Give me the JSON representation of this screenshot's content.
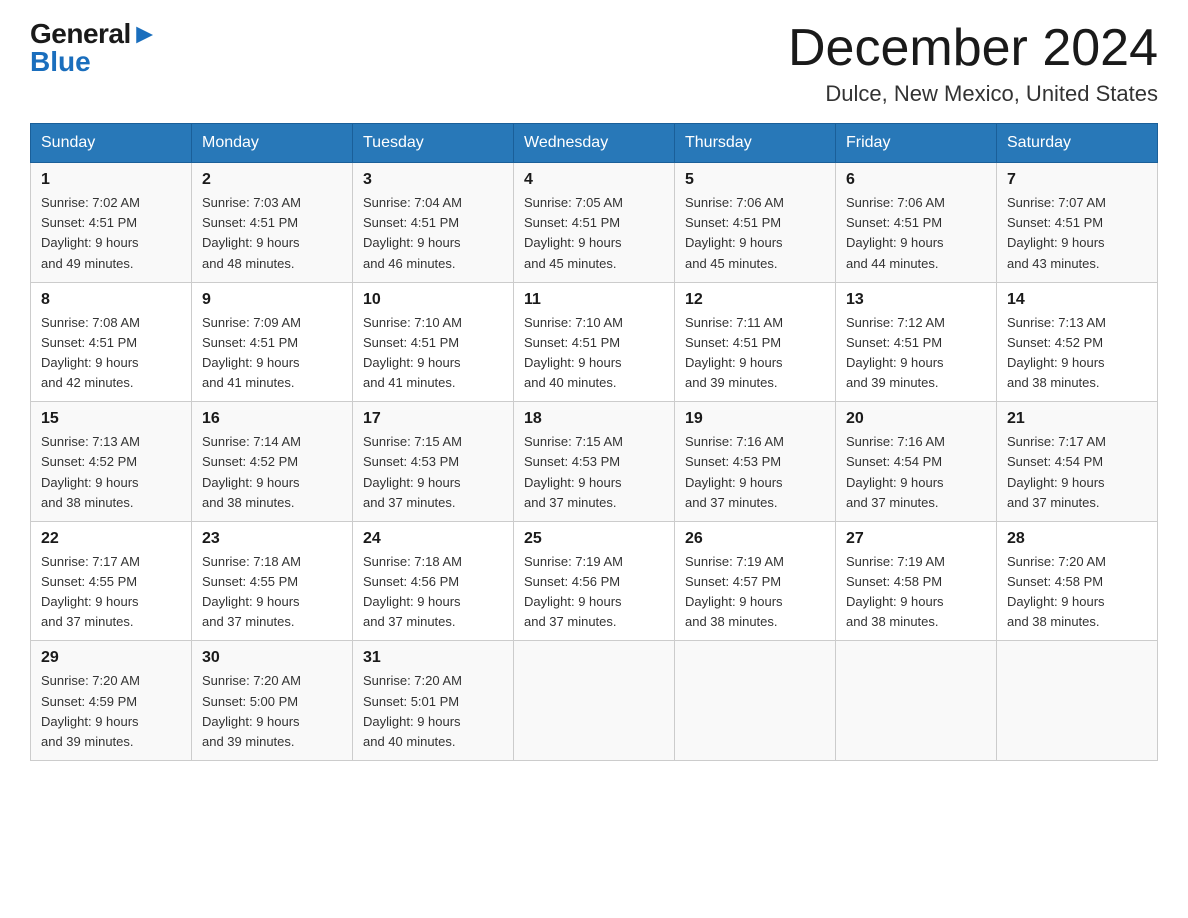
{
  "logo": {
    "general": "General",
    "blue": "Blue",
    "arrow": "▶"
  },
  "header": {
    "month_year": "December 2024",
    "location": "Dulce, New Mexico, United States"
  },
  "weekdays": [
    "Sunday",
    "Monday",
    "Tuesday",
    "Wednesday",
    "Thursday",
    "Friday",
    "Saturday"
  ],
  "weeks": [
    [
      {
        "day": "1",
        "sunrise": "7:02 AM",
        "sunset": "4:51 PM",
        "daylight": "9 hours and 49 minutes."
      },
      {
        "day": "2",
        "sunrise": "7:03 AM",
        "sunset": "4:51 PM",
        "daylight": "9 hours and 48 minutes."
      },
      {
        "day": "3",
        "sunrise": "7:04 AM",
        "sunset": "4:51 PM",
        "daylight": "9 hours and 46 minutes."
      },
      {
        "day": "4",
        "sunrise": "7:05 AM",
        "sunset": "4:51 PM",
        "daylight": "9 hours and 45 minutes."
      },
      {
        "day": "5",
        "sunrise": "7:06 AM",
        "sunset": "4:51 PM",
        "daylight": "9 hours and 45 minutes."
      },
      {
        "day": "6",
        "sunrise": "7:06 AM",
        "sunset": "4:51 PM",
        "daylight": "9 hours and 44 minutes."
      },
      {
        "day": "7",
        "sunrise": "7:07 AM",
        "sunset": "4:51 PM",
        "daylight": "9 hours and 43 minutes."
      }
    ],
    [
      {
        "day": "8",
        "sunrise": "7:08 AM",
        "sunset": "4:51 PM",
        "daylight": "9 hours and 42 minutes."
      },
      {
        "day": "9",
        "sunrise": "7:09 AM",
        "sunset": "4:51 PM",
        "daylight": "9 hours and 41 minutes."
      },
      {
        "day": "10",
        "sunrise": "7:10 AM",
        "sunset": "4:51 PM",
        "daylight": "9 hours and 41 minutes."
      },
      {
        "day": "11",
        "sunrise": "7:10 AM",
        "sunset": "4:51 PM",
        "daylight": "9 hours and 40 minutes."
      },
      {
        "day": "12",
        "sunrise": "7:11 AM",
        "sunset": "4:51 PM",
        "daylight": "9 hours and 39 minutes."
      },
      {
        "day": "13",
        "sunrise": "7:12 AM",
        "sunset": "4:51 PM",
        "daylight": "9 hours and 39 minutes."
      },
      {
        "day": "14",
        "sunrise": "7:13 AM",
        "sunset": "4:52 PM",
        "daylight": "9 hours and 38 minutes."
      }
    ],
    [
      {
        "day": "15",
        "sunrise": "7:13 AM",
        "sunset": "4:52 PM",
        "daylight": "9 hours and 38 minutes."
      },
      {
        "day": "16",
        "sunrise": "7:14 AM",
        "sunset": "4:52 PM",
        "daylight": "9 hours and 38 minutes."
      },
      {
        "day": "17",
        "sunrise": "7:15 AM",
        "sunset": "4:53 PM",
        "daylight": "9 hours and 37 minutes."
      },
      {
        "day": "18",
        "sunrise": "7:15 AM",
        "sunset": "4:53 PM",
        "daylight": "9 hours and 37 minutes."
      },
      {
        "day": "19",
        "sunrise": "7:16 AM",
        "sunset": "4:53 PM",
        "daylight": "9 hours and 37 minutes."
      },
      {
        "day": "20",
        "sunrise": "7:16 AM",
        "sunset": "4:54 PM",
        "daylight": "9 hours and 37 minutes."
      },
      {
        "day": "21",
        "sunrise": "7:17 AM",
        "sunset": "4:54 PM",
        "daylight": "9 hours and 37 minutes."
      }
    ],
    [
      {
        "day": "22",
        "sunrise": "7:17 AM",
        "sunset": "4:55 PM",
        "daylight": "9 hours and 37 minutes."
      },
      {
        "day": "23",
        "sunrise": "7:18 AM",
        "sunset": "4:55 PM",
        "daylight": "9 hours and 37 minutes."
      },
      {
        "day": "24",
        "sunrise": "7:18 AM",
        "sunset": "4:56 PM",
        "daylight": "9 hours and 37 minutes."
      },
      {
        "day": "25",
        "sunrise": "7:19 AM",
        "sunset": "4:56 PM",
        "daylight": "9 hours and 37 minutes."
      },
      {
        "day": "26",
        "sunrise": "7:19 AM",
        "sunset": "4:57 PM",
        "daylight": "9 hours and 38 minutes."
      },
      {
        "day": "27",
        "sunrise": "7:19 AM",
        "sunset": "4:58 PM",
        "daylight": "9 hours and 38 minutes."
      },
      {
        "day": "28",
        "sunrise": "7:20 AM",
        "sunset": "4:58 PM",
        "daylight": "9 hours and 38 minutes."
      }
    ],
    [
      {
        "day": "29",
        "sunrise": "7:20 AM",
        "sunset": "4:59 PM",
        "daylight": "9 hours and 39 minutes."
      },
      {
        "day": "30",
        "sunrise": "7:20 AM",
        "sunset": "5:00 PM",
        "daylight": "9 hours and 39 minutes."
      },
      {
        "day": "31",
        "sunrise": "7:20 AM",
        "sunset": "5:01 PM",
        "daylight": "9 hours and 40 minutes."
      },
      null,
      null,
      null,
      null
    ]
  ],
  "labels": {
    "sunrise": "Sunrise:",
    "sunset": "Sunset:",
    "daylight": "Daylight:"
  }
}
